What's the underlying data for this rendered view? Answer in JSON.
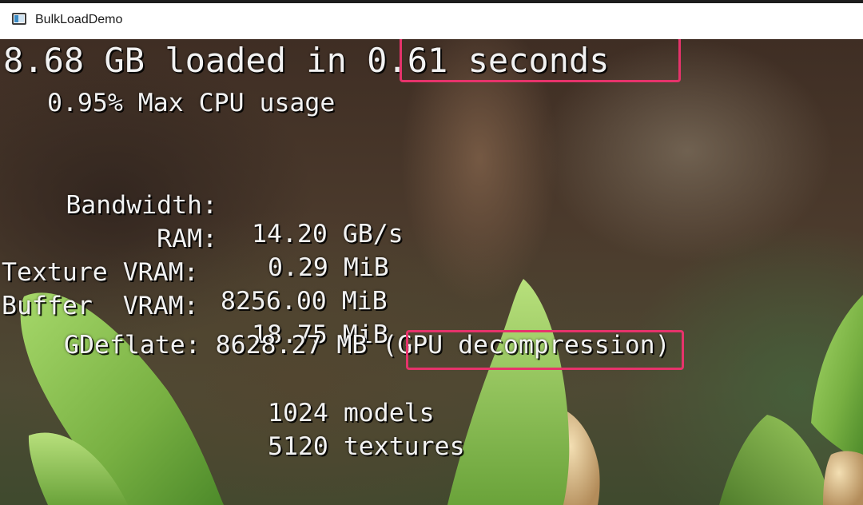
{
  "window": {
    "title": "BulkLoadDemo",
    "icon": "app-window-icon"
  },
  "headline": {
    "amount": "8.68 GB loaded in ",
    "time": "0.61 seconds"
  },
  "cpu_line": "0.95% Max CPU usage",
  "stats": [
    {
      "label": "Bandwidth:",
      "value": "14.20 GB/s"
    },
    {
      "label": "RAM:",
      "value": "0.29 MiB"
    },
    {
      "label": "Texture VRAM:",
      "value": "8256.00 MiB"
    },
    {
      "label": "Buffer  VRAM:",
      "value": "18.75 MiB"
    }
  ],
  "gdeflate": {
    "label": "GDeflate:",
    "value": "8628.27 MB (",
    "mode": "GPU decompression",
    "close": ")"
  },
  "counts": {
    "models": "1024 models",
    "textures": "5120 textures"
  },
  "colors": {
    "highlight": "#e6336b",
    "text": "#f2f2f2",
    "leaf": "#7fb84a"
  }
}
